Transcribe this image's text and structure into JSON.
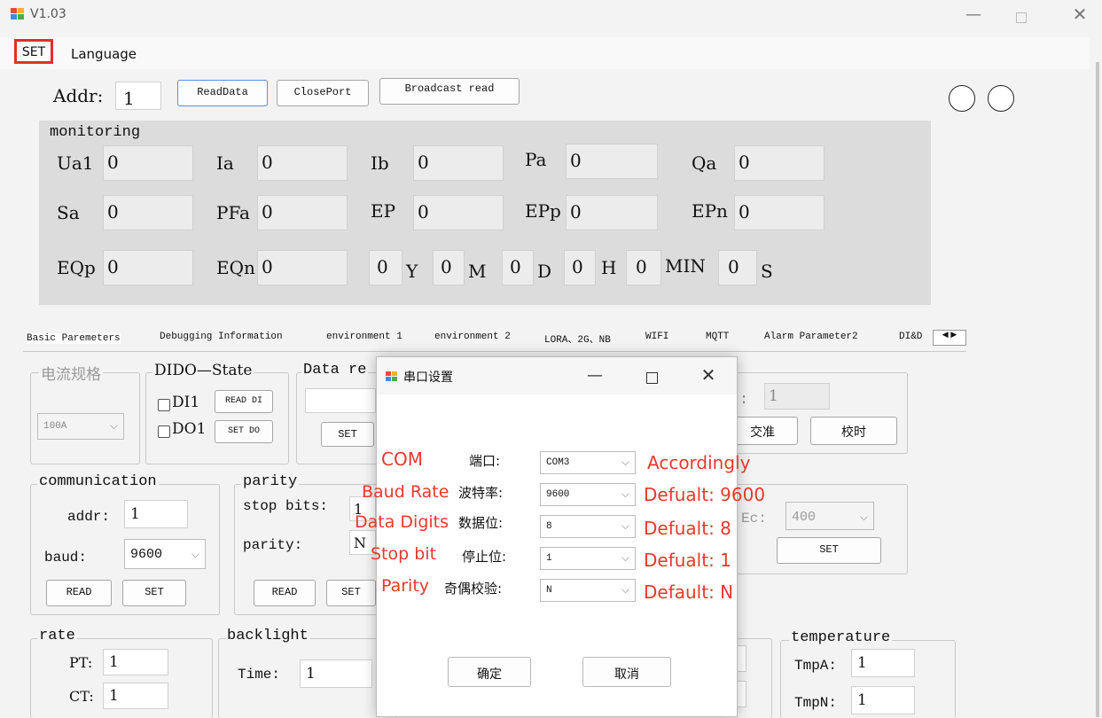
{
  "window": {
    "title": "V1.03"
  },
  "menu": {
    "set": "SET",
    "language": "Language"
  },
  "top": {
    "addr_label": "Addr:",
    "addr_value": "1",
    "read_data": "ReadData",
    "close_port": "ClosePort",
    "broadcast_read": "Broadcast read"
  },
  "monitoring": {
    "title": "monitoring",
    "row1": [
      {
        "label": "Ua1",
        "value": "0"
      },
      {
        "label": "Ia",
        "value": "0"
      },
      {
        "label": "Ib",
        "value": "0"
      },
      {
        "label": "Pa",
        "value": "0"
      },
      {
        "label": "Qa",
        "value": "0"
      }
    ],
    "row2": [
      {
        "label": "Sa",
        "value": "0"
      },
      {
        "label": "PFa",
        "value": "0"
      },
      {
        "label": "EP",
        "value": "0"
      },
      {
        "label": "EPp",
        "value": "0"
      },
      {
        "label": "EPn",
        "value": "0"
      }
    ],
    "row3": [
      {
        "label": "EQp",
        "value": "0"
      },
      {
        "label": "EQn",
        "value": "0"
      }
    ],
    "datetime": [
      {
        "value": "0",
        "unit": "Y"
      },
      {
        "value": "0",
        "unit": "M"
      },
      {
        "value": "0",
        "unit": "D"
      },
      {
        "value": "0",
        "unit": "H"
      },
      {
        "value": "0",
        "unit": "MIN"
      },
      {
        "value": "0",
        "unit": "S"
      }
    ]
  },
  "tabs": [
    "Basic Paremeters",
    "Debugging Information",
    "environment 1",
    "environment 2",
    "LORA、2G、NB",
    "WIFI",
    "MQTT",
    "Alarm Parameter2",
    "DI&D"
  ],
  "current_spec": {
    "title": "电流规格",
    "value": "100A"
  },
  "dido": {
    "title": "DIDO—State",
    "di1": "DI1",
    "read_di": "READ DI",
    "do1": "DO1",
    "set_do": "SET DO"
  },
  "data_re": {
    "title": "Data re",
    "set": "SET"
  },
  "right_top": {
    "partial_label": ":",
    "value": "1",
    "calibrate_partial": "交准",
    "time_sync": "校时"
  },
  "communication": {
    "title": "communication",
    "addr_label": "addr:",
    "addr_value": "1",
    "baud_label": "baud:",
    "baud_value": "9600",
    "read": "READ",
    "set": "SET"
  },
  "parity_group": {
    "title": "parity",
    "stop_bits_label": "stop bits:",
    "stop_bits_value": "1",
    "parity_label": "parity:",
    "parity_value": "N",
    "read": "READ",
    "set": "SET"
  },
  "ec_group": {
    "label": "Ec:",
    "value": "400",
    "set": "SET"
  },
  "rate": {
    "title": "rate",
    "pt_label": "PT:",
    "pt_value": "1",
    "ct_label": "CT:",
    "ct_value": "1"
  },
  "backlight": {
    "title": "backlight",
    "time_label": "Time:",
    "time_value": "1"
  },
  "temperature": {
    "title": "temperature",
    "tmpa_label": "TmpA:",
    "tmpa_value": "1",
    "tmpn_label": "TmpN:",
    "tmpn_value": "1"
  },
  "dialog": {
    "title": "串口设置",
    "rows": [
      {
        "cn": "端口:",
        "value": "COM3"
      },
      {
        "cn": "波特率:",
        "value": "9600"
      },
      {
        "cn": "数据位:",
        "value": "8"
      },
      {
        "cn": "停止位:",
        "value": "1"
      },
      {
        "cn": "奇偶校验:",
        "value": "N"
      }
    ],
    "ok": "确定",
    "cancel": "取消"
  },
  "annotations": {
    "left": [
      "COM",
      "Baud Rate",
      "Data Digits",
      "Stop bit",
      "Parity"
    ],
    "right": [
      "Accordingly",
      "Defualt: 9600",
      "Defualt: 8",
      "Defualt: 1",
      "Default: N"
    ],
    "color": "#e53a2c"
  }
}
